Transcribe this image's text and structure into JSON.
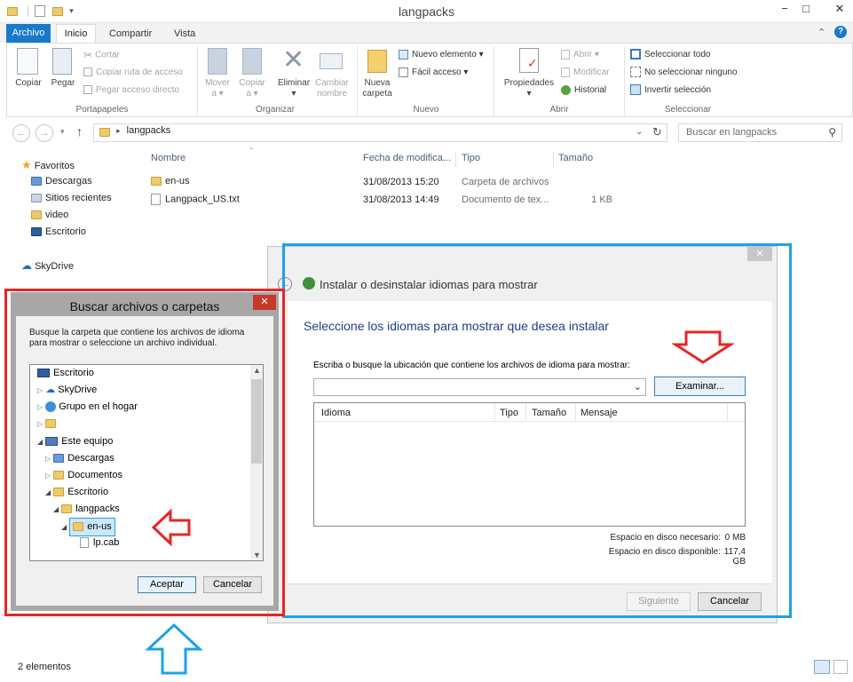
{
  "window": {
    "title": "langpacks",
    "minimize": "−",
    "maximize": "□",
    "close": "✕"
  },
  "ribbon_tabs": {
    "archivo": "Archivo",
    "inicio": "Inicio",
    "compartir": "Compartir",
    "vista": "Vista"
  },
  "ribbon": {
    "copiar": "Copiar",
    "pegar": "Pegar",
    "cortar": "Cortar",
    "copiar_ruta": "Copiar ruta de acceso",
    "pegar_acceso": "Pegar acceso directo",
    "portapapeles": "Portapapeles",
    "mover_a_1": "Mover",
    "mover_a_2": "a",
    "copiar_a_1": "Copiar",
    "copiar_a_2": "a",
    "eliminar": "Eliminar",
    "cambiar_1": "Cambiar",
    "cambiar_2": "nombre",
    "organizar": "Organizar",
    "nueva_carpeta_1": "Nueva",
    "nueva_carpeta_2": "carpeta",
    "nuevo_elemento": "Nuevo elemento",
    "facil_acceso": "Fácil acceso",
    "nuevo": "Nuevo",
    "propiedades": "Propiedades",
    "abrir_item": "Abrir",
    "modificar": "Modificar",
    "historial": "Historial",
    "abrir": "Abrir",
    "sel_todo": "Seleccionar todo",
    "no_sel": "No seleccionar ninguno",
    "invertir": "Invertir selección",
    "seleccionar": "Seleccionar"
  },
  "address": {
    "path": "langpacks",
    "search_placeholder": "Buscar en langpacks"
  },
  "nav": {
    "favoritos": "Favoritos",
    "descargas": "Descargas",
    "sitios": "Sitios recientes",
    "video": "video",
    "escritorio": "Escritorio",
    "skydrive": "SkyDrive"
  },
  "columns": {
    "nombre": "Nombre",
    "fecha": "Fecha de modifica...",
    "tipo": "Tipo",
    "tamano": "Tamaño"
  },
  "files": [
    {
      "name": "en-us",
      "date": "31/08/2013 15:20",
      "type": "Carpeta de archivos",
      "size": ""
    },
    {
      "name": "Langpack_US.txt",
      "date": "31/08/2013 14:49",
      "type": "Documento de tex...",
      "size": "1 KB"
    }
  ],
  "status": {
    "count": "2 elementos"
  },
  "install_dialog": {
    "title": "Instalar o desinstalar idiomas para mostrar",
    "heading": "Seleccione los idiomas para mostrar que desea instalar",
    "prompt": "Escriba o busque la ubicación que contiene los archivos de idioma para mostrar:",
    "path_value": "",
    "browse": "Examinar...",
    "table_headers": {
      "idioma": "Idioma",
      "tipo": "Tipo",
      "tamano": "Tamaño",
      "mensaje": "Mensaje"
    },
    "space_needed_label": "Espacio en disco necesario:",
    "space_needed": "0 MB",
    "space_avail_label": "Espacio en disco disponible:",
    "space_avail": "117,4 GB",
    "next": "Siguiente",
    "cancel": "Cancelar",
    "close": "✕"
  },
  "browse_dialog": {
    "title": "Buscar archivos o carpetas",
    "desc": "Busque la carpeta que contiene los archivos de idioma para mostrar o seleccione un archivo individual.",
    "tree": {
      "escritorio": "Escritorio",
      "skydrive": "SkyDrive",
      "grupo": "Grupo en el hogar",
      "equipo": "Este equipo",
      "descargas": "Descargas",
      "documentos": "Documentos",
      "escritorio2": "Escritorio",
      "langpacks": "langpacks",
      "enus": "en-us",
      "lpcab": "lp.cab"
    },
    "ok": "Aceptar",
    "cancel": "Cancelar",
    "close": "✕"
  }
}
